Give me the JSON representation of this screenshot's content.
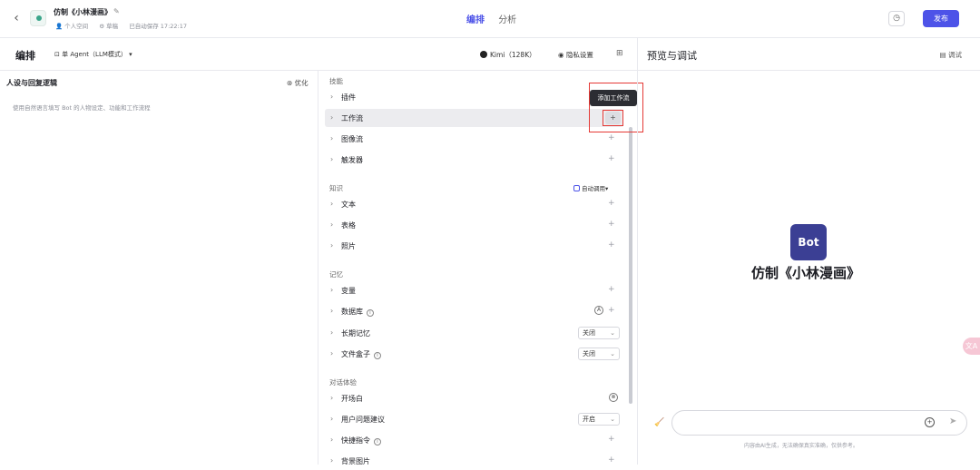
{
  "header": {
    "back_icon": "chevron-left-icon",
    "bot_name": "仿制《小林漫画》",
    "space": "个人空间",
    "status": "草稿",
    "autosave": "已自动保存 17:22:17",
    "tabs": [
      {
        "label": "编排",
        "active": true
      },
      {
        "label": "分析",
        "active": false
      }
    ],
    "publish_label": "发布"
  },
  "editor": {
    "title": "编排",
    "mode": "单 Agent（LLM模式）",
    "model": "Kimi（128K）",
    "privacy": "隐私设置"
  },
  "persona": {
    "title": "人设与回复逻辑",
    "optimize": "优化",
    "placeholder": "使用自然语言填写 Bot 的人物设定、功能和工作流程"
  },
  "skills": {
    "section_label": "技能",
    "items": [
      "插件",
      "工作流",
      "图像流",
      "触发器"
    ]
  },
  "knowledge": {
    "section_label": "知识",
    "auto_call": "自动调用",
    "items": [
      "文本",
      "表格",
      "照片"
    ]
  },
  "memory": {
    "section_label": "记忆",
    "variables": "变量",
    "database": "数据库",
    "long_term": "长期记忆",
    "long_term_value": "关闭",
    "filebox": "文件盒子",
    "filebox_value": "关闭"
  },
  "dialog": {
    "section_label": "对话体验",
    "opening": "开场白",
    "suggest": "用户问题建议",
    "suggest_value": "开启",
    "shortcut": "快捷指令",
    "background": "背景图片"
  },
  "tooltip": "添加工作流",
  "preview": {
    "title": "预览与调试",
    "debug": "调试",
    "bot_logo": "Bot",
    "bot_name": "仿制《小林漫画》",
    "floating_label": "文A",
    "disclaimer": "内容由AI生成，无法确保真实准确，仅供参考。"
  },
  "colors": {
    "accent": "#4d53e8",
    "highlight": "#e53935"
  }
}
